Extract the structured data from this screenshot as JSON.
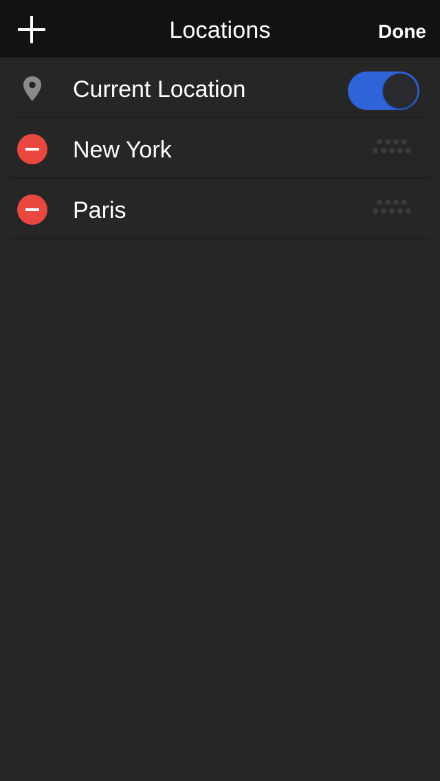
{
  "navbar": {
    "add_icon": "plus-icon",
    "title": "Locations",
    "done_label": "Done"
  },
  "locations": {
    "current": {
      "label": "Current Location",
      "icon": "location-pin-icon",
      "toggle_on": true,
      "toggle_color": "#2f63d8"
    },
    "items": [
      {
        "label": "New York",
        "delete_icon": "minus-circle-icon",
        "handle_icon": "drag-handle-icon"
      },
      {
        "label": "Paris",
        "delete_icon": "minus-circle-icon",
        "handle_icon": "drag-handle-icon"
      }
    ]
  },
  "colors": {
    "background": "#262626",
    "navbar": "#121212",
    "delete": "#e8483f",
    "accent": "#2f63d8"
  }
}
